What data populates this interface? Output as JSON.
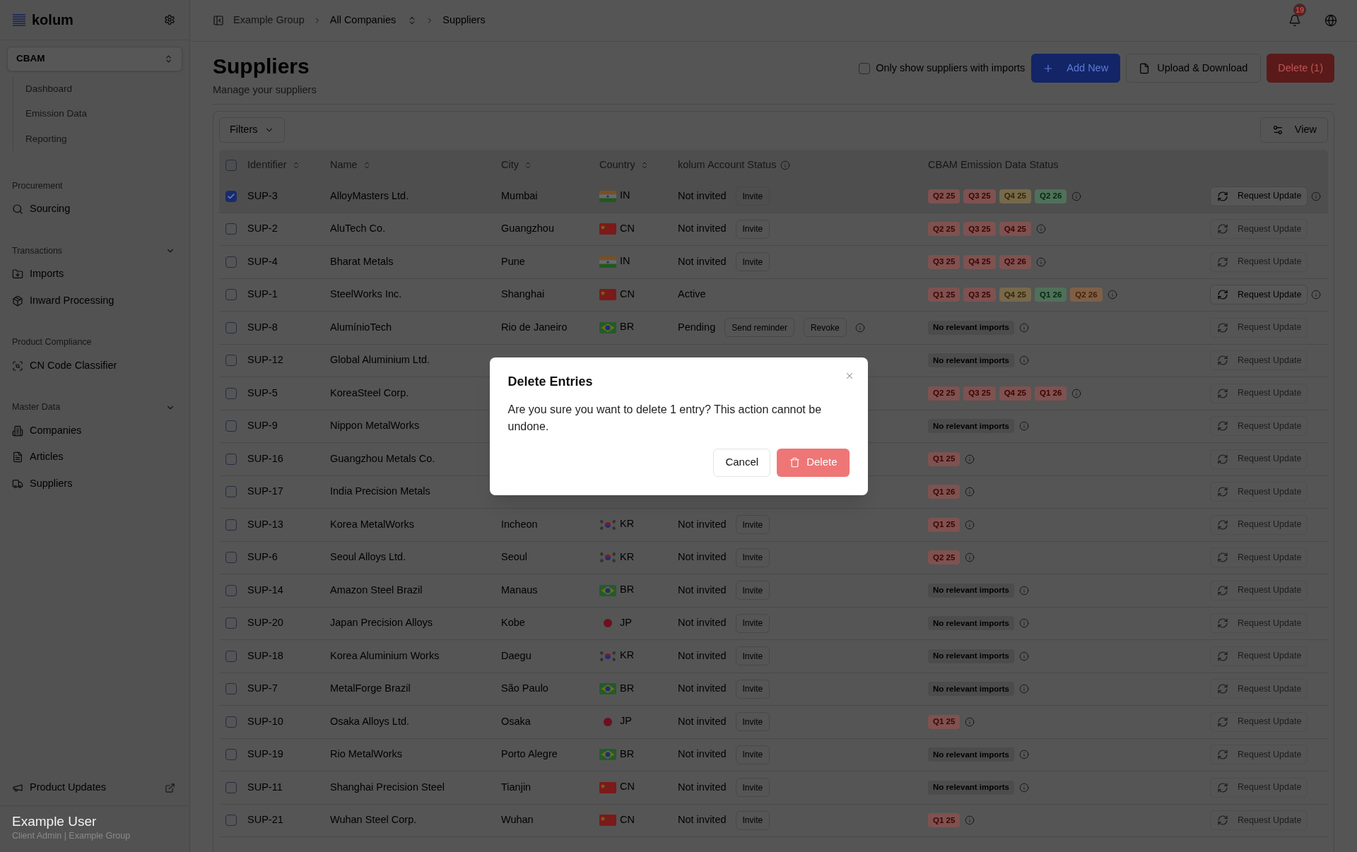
{
  "sidebar": {
    "logo": "kolum",
    "module_switcher": "CBAM",
    "module_items": [
      "Dashboard",
      "Emission Data",
      "Reporting"
    ],
    "sections": [
      {
        "title": "Procurement",
        "collapsible": false,
        "items": [
          {
            "label": "Sourcing",
            "kind": "search"
          }
        ]
      },
      {
        "title": "Transactions",
        "collapsible": true,
        "items": [
          {
            "label": "Imports",
            "kind": "folder"
          },
          {
            "label": "Inward Processing",
            "kind": "package"
          }
        ]
      },
      {
        "title": "Product Compliance",
        "collapsible": false,
        "items": [
          {
            "label": "CN Code Classifier",
            "kind": "scan"
          }
        ]
      },
      {
        "title": "Master Data",
        "collapsible": true,
        "items": [
          {
            "label": "Companies",
            "kind": "building"
          },
          {
            "label": "Articles",
            "kind": "document"
          },
          {
            "label": "Suppliers",
            "kind": "truck"
          }
        ]
      }
    ],
    "footer_link": "Product Updates",
    "user": {
      "name": "Example User",
      "role": "Client Admin | Example Group"
    }
  },
  "header": {
    "breadcrumb": [
      {
        "label": "Example Group",
        "kind": "link"
      },
      {
        "label": "All Companies",
        "kind": "switcher"
      },
      {
        "label": "Suppliers",
        "kind": "current"
      }
    ],
    "notification_count": "19"
  },
  "page": {
    "title": "Suppliers",
    "subtitle": "Manage your suppliers",
    "imports_filter": {
      "label": "Only show suppliers with imports",
      "checked": false
    },
    "actions": [
      {
        "label": "Add New",
        "kind": "primary"
      },
      {
        "label": "Upload & Download",
        "kind": "outline"
      },
      {
        "label": "Delete (1)",
        "kind": "danger"
      }
    ]
  },
  "table": {
    "filters_button": "Filters",
    "view_button": "View",
    "select_all": {
      "checked": false
    },
    "columns": [
      {
        "label": "Identifier",
        "sortable": true,
        "info": false
      },
      {
        "label": "Name",
        "sortable": true,
        "info": false
      },
      {
        "label": "City",
        "sortable": true,
        "info": false
      },
      {
        "label": "Country",
        "sortable": true,
        "info": false
      },
      {
        "label": "kolum Account Status",
        "sortable": false,
        "info": true
      },
      {
        "label": "CBAM Emission Data Status",
        "sortable": false,
        "info": false
      }
    ],
    "rows": [
      {
        "id": "SUP-3",
        "name": "AlloyMasters Ltd.",
        "selected": true,
        "city": "Mumbai",
        "country": {
          "code": "IN",
          "kind": "india"
        },
        "account": {
          "status": "Not invited",
          "actions": [
            "Invite"
          ],
          "info": false
        },
        "emission_badges": [
          {
            "label": "Q2 25",
            "color": "#7e5250"
          },
          {
            "label": "Q3 25",
            "color": "#7e5250"
          },
          {
            "label": "Q4 25",
            "color": "#76694c"
          },
          {
            "label": "Q2 26",
            "color": "#50705a"
          }
        ],
        "request_update": {
          "label": "Request Update",
          "disabled": false
        }
      },
      {
        "id": "SUP-2",
        "name": "AluTech Co.",
        "selected": false,
        "city": "Guangzhou",
        "country": {
          "code": "CN",
          "kind": "china"
        },
        "account": {
          "status": "Not invited",
          "actions": [
            "Invite"
          ],
          "info": false
        },
        "emission_badges": [
          {
            "label": "Q2 25",
            "color": "#7e5250"
          },
          {
            "label": "Q3 25",
            "color": "#7e5250"
          },
          {
            "label": "Q4 25",
            "color": "#7e5250"
          }
        ],
        "request_update": {
          "label": "Request Update",
          "disabled": true
        }
      },
      {
        "id": "SUP-4",
        "name": "Bharat Metals",
        "selected": false,
        "city": "Pune",
        "country": {
          "code": "IN",
          "kind": "india"
        },
        "account": {
          "status": "Not invited",
          "actions": [
            "Invite"
          ],
          "info": false
        },
        "emission_badges": [
          {
            "label": "Q3 25",
            "color": "#7e5250"
          },
          {
            "label": "Q4 25",
            "color": "#7e5250"
          },
          {
            "label": "Q2 26",
            "color": "#7e5250"
          }
        ],
        "request_update": {
          "label": "Request Update",
          "disabled": true
        }
      },
      {
        "id": "SUP-1",
        "name": "SteelWorks Inc.",
        "selected": false,
        "city": "Shanghai",
        "country": {
          "code": "CN",
          "kind": "china"
        },
        "account": {
          "status": "Active",
          "info": false
        },
        "emission_badges": [
          {
            "label": "Q1 25",
            "color": "#7e5250"
          },
          {
            "label": "Q3 25",
            "color": "#7e5250"
          },
          {
            "label": "Q4 25",
            "color": "#76694c"
          },
          {
            "label": "Q1 26",
            "color": "#50705a"
          },
          {
            "label": "Q2 26",
            "color": "#7e6048"
          }
        ],
        "request_update": {
          "label": "Request Update",
          "disabled": false
        }
      },
      {
        "id": "SUP-8",
        "name": "AlumínioTech",
        "selected": false,
        "city": "Rio de Janeiro",
        "country": {
          "code": "BR",
          "kind": "brazil"
        },
        "account": {
          "status": "Pending",
          "actions": [
            "Send reminder",
            "Revoke"
          ],
          "info": true
        },
        "emission_note": "No relevant imports",
        "request_update": {
          "label": "Request Update",
          "disabled": true
        }
      },
      {
        "id": "SUP-12",
        "name": "Global Aluminium Ltd.",
        "selected": false,
        "emission_note": "No relevant imports",
        "request_update": {
          "label": "Request Update",
          "disabled": true
        }
      },
      {
        "id": "SUP-5",
        "name": "KoreaSteel Corp.",
        "selected": false,
        "emission_badges": [
          {
            "label": "Q2 25",
            "color": "#7e5250"
          },
          {
            "label": "Q3 25",
            "color": "#7e5250"
          },
          {
            "label": "Q4 25",
            "color": "#7e5250"
          },
          {
            "label": "Q1 26",
            "color": "#7e5250"
          }
        ],
        "request_update": {
          "label": "Request Update",
          "disabled": true
        }
      },
      {
        "id": "SUP-9",
        "name": "Nippon MetalWorks",
        "selected": false,
        "emission_note": "No relevant imports",
        "request_update": {
          "label": "Request Update",
          "disabled": true
        }
      },
      {
        "id": "SUP-16",
        "name": "Guangzhou Metals Co.",
        "selected": false,
        "emission_badges": [
          {
            "label": "Q1 25",
            "color": "#7e5250"
          }
        ],
        "request_update": {
          "label": "Request Update",
          "disabled": true
        }
      },
      {
        "id": "SUP-17",
        "name": "India Precision Metals",
        "selected": false,
        "emission_badges": [
          {
            "label": "Q1 26",
            "color": "#7e5250"
          }
        ],
        "request_update": {
          "label": "Request Update",
          "disabled": true
        }
      },
      {
        "id": "SUP-13",
        "name": "Korea MetalWorks",
        "selected": false,
        "city": "Incheon",
        "country": {
          "code": "KR",
          "kind": "korea"
        },
        "account": {
          "status": "Not invited",
          "actions": [
            "Invite"
          ],
          "info": false
        },
        "emission_badges": [
          {
            "label": "Q1 25",
            "color": "#7e5250"
          }
        ],
        "request_update": {
          "label": "Request Update",
          "disabled": true
        }
      },
      {
        "id": "SUP-6",
        "name": "Seoul Alloys Ltd.",
        "selected": false,
        "city": "Seoul",
        "country": {
          "code": "KR",
          "kind": "korea"
        },
        "account": {
          "status": "Not invited",
          "actions": [
            "Invite"
          ],
          "info": false
        },
        "emission_badges": [
          {
            "label": "Q2 25",
            "color": "#7e5250"
          }
        ],
        "request_update": {
          "label": "Request Update",
          "disabled": true
        }
      },
      {
        "id": "SUP-14",
        "name": "Amazon Steel Brazil",
        "selected": false,
        "city": "Manaus",
        "country": {
          "code": "BR",
          "kind": "brazil"
        },
        "account": {
          "status": "Not invited",
          "actions": [
            "Invite"
          ],
          "info": false
        },
        "emission_note": "No relevant imports",
        "request_update": {
          "label": "Request Update",
          "disabled": true
        }
      },
      {
        "id": "SUP-20",
        "name": "Japan Precision Alloys",
        "selected": false,
        "city": "Kobe",
        "country": {
          "code": "JP",
          "kind": "japan"
        },
        "account": {
          "status": "Not invited",
          "actions": [
            "Invite"
          ],
          "info": false
        },
        "emission_note": "No relevant imports",
        "request_update": {
          "label": "Request Update",
          "disabled": true
        }
      },
      {
        "id": "SUP-18",
        "name": "Korea Aluminium Works",
        "selected": false,
        "city": "Daegu",
        "country": {
          "code": "KR",
          "kind": "korea"
        },
        "account": {
          "status": "Not invited",
          "actions": [
            "Invite"
          ],
          "info": false
        },
        "emission_note": "No relevant imports",
        "request_update": {
          "label": "Request Update",
          "disabled": true
        }
      },
      {
        "id": "SUP-7",
        "name": "MetalForge Brazil",
        "selected": false,
        "city": "São Paulo",
        "country": {
          "code": "BR",
          "kind": "brazil"
        },
        "account": {
          "status": "Not invited",
          "actions": [
            "Invite"
          ],
          "info": false
        },
        "emission_note": "No relevant imports",
        "request_update": {
          "label": "Request Update",
          "disabled": true
        }
      },
      {
        "id": "SUP-10",
        "name": "Osaka Alloys Ltd.",
        "selected": false,
        "city": "Osaka",
        "country": {
          "code": "JP",
          "kind": "japan"
        },
        "account": {
          "status": "Not invited",
          "actions": [
            "Invite"
          ],
          "info": false
        },
        "emission_badges": [
          {
            "label": "Q1 25",
            "color": "#7e5250"
          }
        ],
        "request_update": {
          "label": "Request Update",
          "disabled": true
        }
      },
      {
        "id": "SUP-19",
        "name": "Rio MetalWorks",
        "selected": false,
        "city": "Porto Alegre",
        "country": {
          "code": "BR",
          "kind": "brazil"
        },
        "account": {
          "status": "Not invited",
          "actions": [
            "Invite"
          ],
          "info": false
        },
        "emission_note": "No relevant imports",
        "request_update": {
          "label": "Request Update",
          "disabled": true
        }
      },
      {
        "id": "SUP-11",
        "name": "Shanghai Precision Steel",
        "selected": false,
        "city": "Tianjin",
        "country": {
          "code": "CN",
          "kind": "china"
        },
        "account": {
          "status": "Not invited",
          "actions": [
            "Invite"
          ],
          "info": false
        },
        "emission_note": "No relevant imports",
        "request_update": {
          "label": "Request Update",
          "disabled": true
        }
      },
      {
        "id": "SUP-21",
        "name": "Wuhan Steel Corp.",
        "selected": false,
        "city": "Wuhan",
        "country": {
          "code": "CN",
          "kind": "china"
        },
        "account": {
          "status": "Not invited",
          "actions": [
            "Invite"
          ],
          "info": false
        },
        "emission_badges": [
          {
            "label": "Q1 25",
            "color": "#7e5250"
          }
        ],
        "request_update": {
          "label": "Request Update",
          "disabled": true
        }
      }
    ]
  },
  "dialog": {
    "title": "Delete Entries",
    "message": "Are you sure you want to delete 1 entry? This action cannot be undone.",
    "buttons": [
      {
        "label": "Cancel",
        "kind": "secondary"
      },
      {
        "label": "Delete",
        "kind": "danger"
      }
    ]
  }
}
